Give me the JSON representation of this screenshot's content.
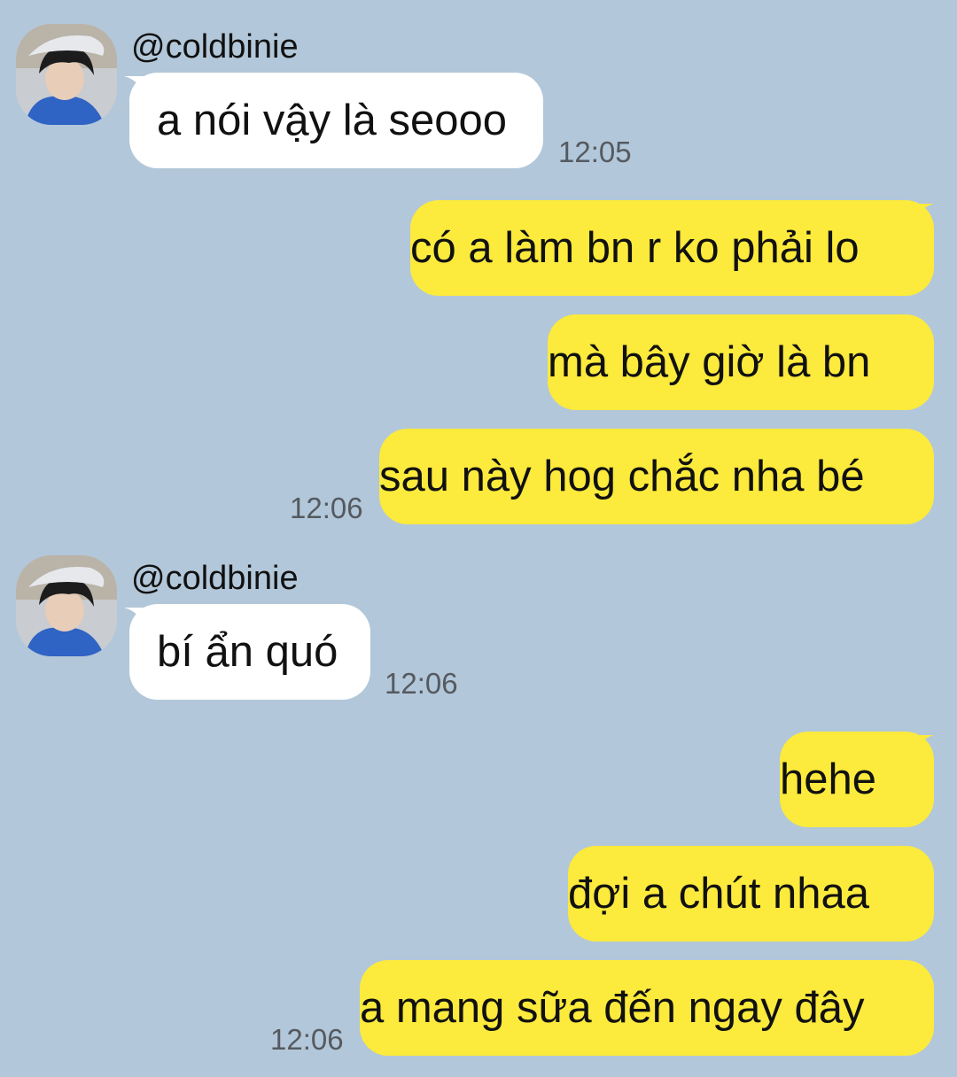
{
  "colors": {
    "background": "#b2c7d9",
    "incoming_bubble": "#ffffff",
    "outgoing_bubble": "#fcea3c",
    "timestamp": "#555a60"
  },
  "groups": [
    {
      "sender": "@coldbinie",
      "avatar": "avatar-icon",
      "messages": [
        "a nói vậy là seooo"
      ],
      "time": "12:05"
    },
    {
      "direction": "outgoing",
      "messages": [
        "có a làm bn r ko phải lo",
        "mà bây giờ là bn",
        "sau này hog chắc nha bé"
      ],
      "time": "12:06"
    },
    {
      "sender": "@coldbinie",
      "avatar": "avatar-icon",
      "messages": [
        "bí ẩn quó"
      ],
      "time": "12:06"
    },
    {
      "direction": "outgoing",
      "messages": [
        "hehe",
        "đợi a chút nhaa",
        "a mang sữa đến ngay đây"
      ],
      "time": "12:06"
    }
  ]
}
